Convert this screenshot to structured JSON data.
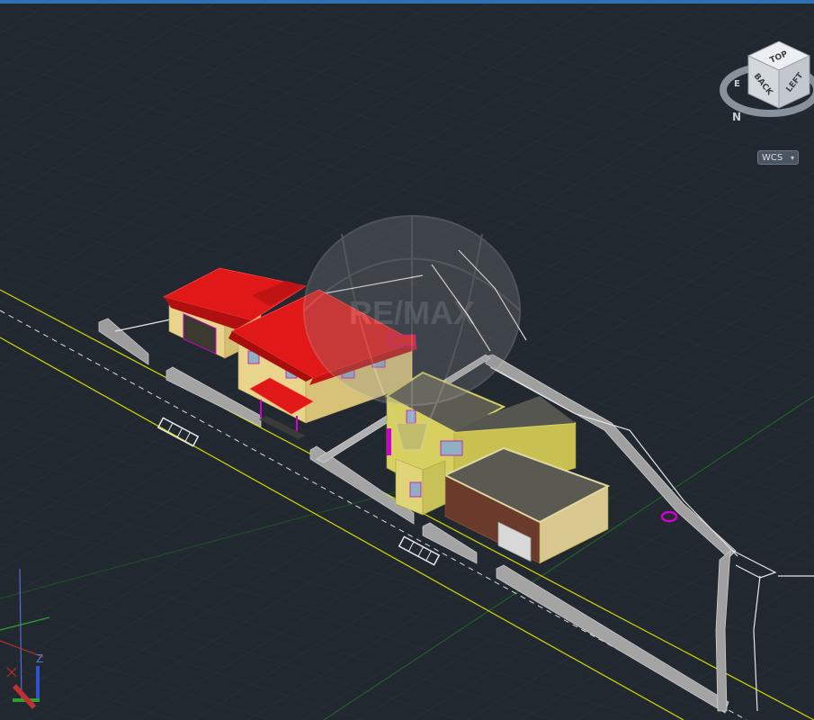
{
  "viewport": {
    "background": "#212830"
  },
  "viewcube": {
    "faces": {
      "top": "TOP",
      "back": "BACK",
      "left": "LEFT"
    },
    "compass_north": "N",
    "compass_east": "E"
  },
  "ucs_menu": {
    "label": "WCS",
    "arrow": "▾"
  },
  "ucs_icon": {
    "z_label": "Z"
  },
  "watermark": {
    "text": "RE/MAX"
  },
  "colors": {
    "roof": "#e01818",
    "wall": "#e8d48a",
    "modern_wall": "#d7d060",
    "flat_roof": "#5a5a52",
    "fence": "#a8a8a8",
    "property_line_yellow": "#d8d800",
    "grid_line": "#2d353f",
    "axis_green": "#2fa02f",
    "magenta": "#d000d0"
  }
}
